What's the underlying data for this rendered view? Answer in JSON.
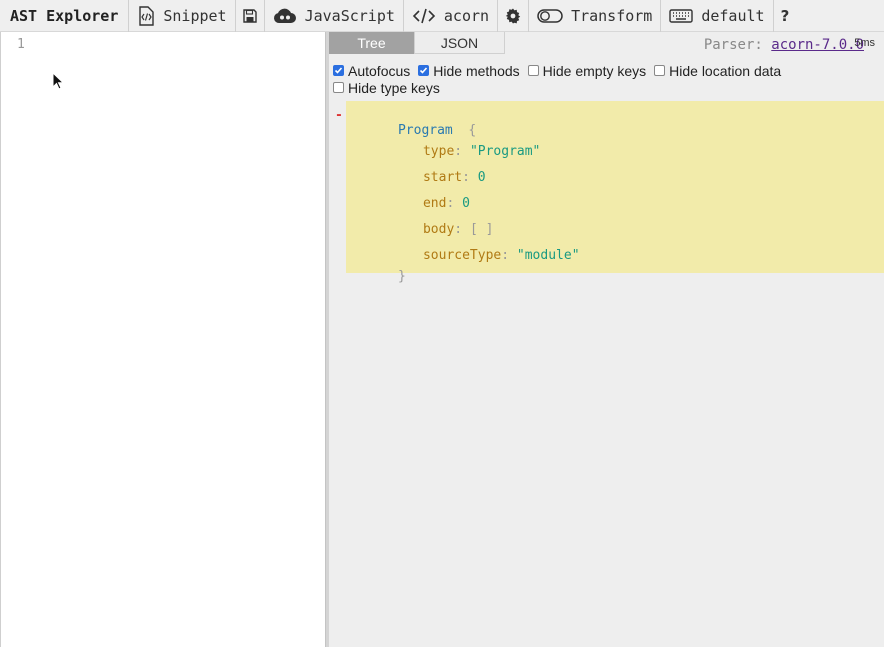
{
  "toolbar": {
    "title": "AST Explorer",
    "snippet_label": "Snippet",
    "language_label": "JavaScript",
    "parser_label": "acorn",
    "transform_label": "Transform",
    "keymap_label": "default",
    "help_label": "?"
  },
  "editor": {
    "line_number": "1"
  },
  "output": {
    "tabs": [
      {
        "label": "Tree",
        "active": true
      },
      {
        "label": "JSON",
        "active": false
      }
    ],
    "parser_prefix": "Parser:",
    "parser_link": "acorn-7.0.0",
    "parse_time": "5ms",
    "options": [
      {
        "label": "Autofocus",
        "checked": true
      },
      {
        "label": "Hide methods",
        "checked": true
      },
      {
        "label": "Hide empty keys",
        "checked": false
      },
      {
        "label": "Hide location data",
        "checked": false
      },
      {
        "label": "Hide type keys",
        "checked": false
      }
    ],
    "tree": {
      "toggle": "-",
      "node_name": "Program",
      "open_brace": "{",
      "close_brace": "}",
      "props": [
        {
          "key": "type",
          "value": "\"Program\""
        },
        {
          "key": "start",
          "value": "0"
        },
        {
          "key": "end",
          "value": "0"
        },
        {
          "key": "body",
          "value": "[ ]"
        },
        {
          "key": "sourceType",
          "value": "\"module\""
        }
      ]
    }
  },
  "colors": {
    "tree_highlight": "#f2ebaa",
    "tab_active": "#a2a2a2",
    "checkbox_checked": "#2b6fe0",
    "node_name": "#2a7ab0",
    "key": "#b07a14",
    "value": "#1a9a82"
  }
}
